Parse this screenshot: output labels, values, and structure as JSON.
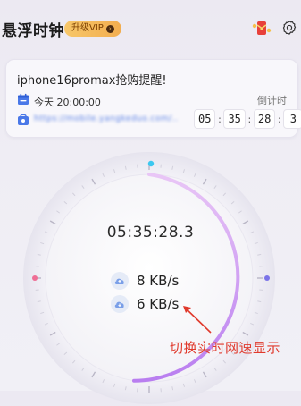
{
  "header": {
    "title": "悬浮时钟",
    "vip_label": "升级VIP",
    "vip_arrow": "›"
  },
  "reminder": {
    "title": "iphone16promax抢购提醒!",
    "time": "今天 20:00:00",
    "url": "https://mobile.yangkeduo.com/...",
    "countdown_label": "倒计时",
    "countdown": [
      "05",
      "35",
      "28",
      "3"
    ]
  },
  "clock": {
    "time": "05:35:28.3",
    "upload_speed": "8 KB/s",
    "download_speed": "6 KB/s"
  },
  "annotation": {
    "text": "切换实时网速显示"
  },
  "colors": {
    "accent_purple": "#c58ef0",
    "dot_cyan": "#3cc8f0",
    "dot_pink": "#ef6e95",
    "dot_blue": "#7b73e8",
    "annotation_red": "#e0392c",
    "vip_gold": "#f2b652"
  },
  "icons": {
    "gift": "red-envelope-icon",
    "settings": "gear-icon",
    "calendar": "calendar-icon",
    "link": "shop-bag-icon",
    "speed": "cloud-transfer-icon"
  }
}
